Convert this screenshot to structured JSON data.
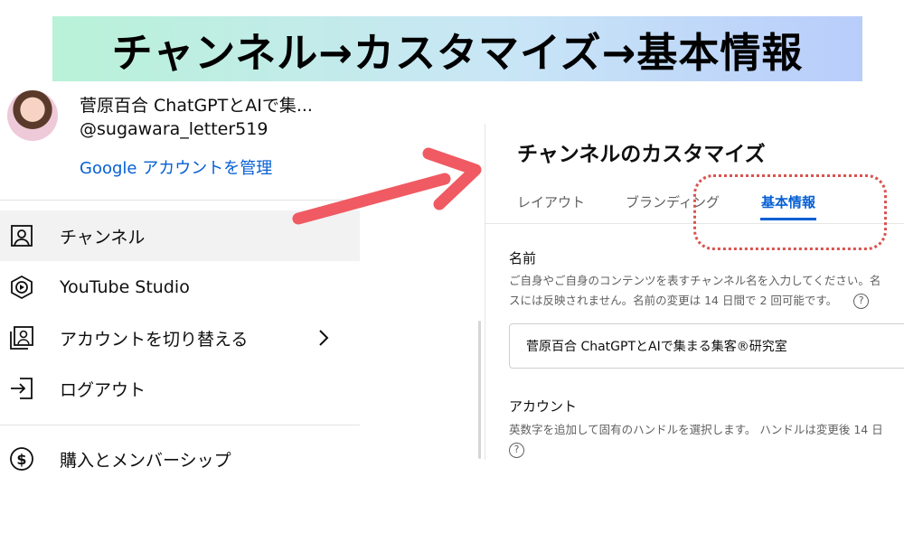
{
  "banner": {
    "title": "チャンネル→カスタマイズ→基本情報"
  },
  "account": {
    "name": "菅原百合 ChatGPTとAIで集...",
    "handle": "@sugawara_letter519",
    "manage_link": "Google アカウントを管理"
  },
  "menu": {
    "items": [
      {
        "label": "チャンネル",
        "icon": "person-box-icon"
      },
      {
        "label": "YouTube Studio",
        "icon": "studio-icon"
      },
      {
        "label": "アカウントを切り替える",
        "icon": "switch-account-icon"
      },
      {
        "label": "ログアウト",
        "icon": "sign-out-icon"
      },
      {
        "label": "購入とメンバーシップ",
        "icon": "dollar-icon"
      }
    ]
  },
  "customize": {
    "title": "チャンネルのカスタマイズ",
    "tabs": [
      {
        "label": "レイアウト"
      },
      {
        "label": "ブランディング"
      },
      {
        "label": "基本情報"
      }
    ],
    "name_section": {
      "title": "名前",
      "desc_line1": "ご自身やご自身のコンテンツを表すチャンネル名を入力してください。名",
      "desc_line2": "スには反映されません。名前の変更は 14 日間で 2 回可能です。",
      "value": "菅原百合 ChatGPTとAIで集まる集客®研究室"
    },
    "account_section": {
      "title": "アカウント",
      "desc_line1": "英数字を追加して固有のハンドルを選択します。 ハンドルは変更後 14 日"
    },
    "help_glyph": "?"
  },
  "colors": {
    "accent": "#065fd4",
    "annotation": "#f05a62",
    "highlight": "#d9534f"
  }
}
